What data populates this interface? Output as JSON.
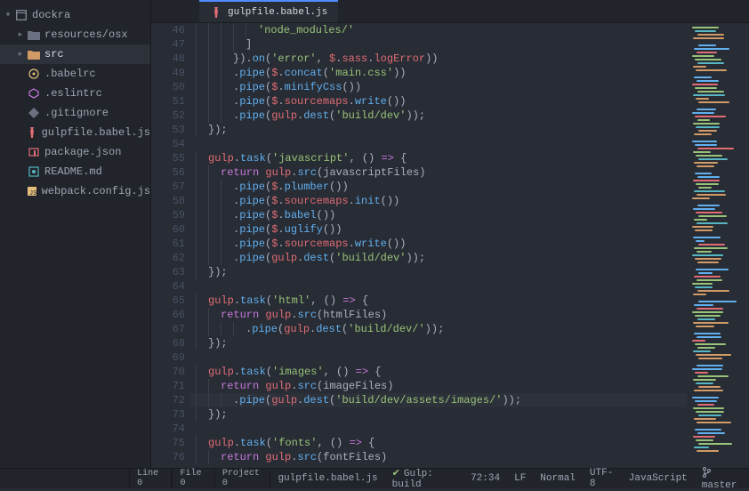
{
  "project": {
    "name": "dockra"
  },
  "tree": [
    {
      "label": "resources/osx",
      "depth": 1,
      "kind": "folder",
      "arrow": "▸",
      "sel": false
    },
    {
      "label": "src",
      "depth": 1,
      "kind": "folder-src",
      "arrow": "▸",
      "sel": true
    },
    {
      "label": ".babelrc",
      "depth": 1,
      "kind": "babel",
      "arrow": "",
      "sel": false
    },
    {
      "label": ".eslintrc",
      "depth": 1,
      "kind": "eslint",
      "arrow": "",
      "sel": false
    },
    {
      "label": ".gitignore",
      "depth": 1,
      "kind": "git",
      "arrow": "",
      "sel": false
    },
    {
      "label": "gulpfile.babel.js",
      "depth": 1,
      "kind": "gulp",
      "arrow": "",
      "sel": false
    },
    {
      "label": "package.json",
      "depth": 1,
      "kind": "npm",
      "arrow": "",
      "sel": false
    },
    {
      "label": "README.md",
      "depth": 1,
      "kind": "md",
      "arrow": "",
      "sel": false
    },
    {
      "label": "webpack.config.js",
      "depth": 1,
      "kind": "js",
      "arrow": "",
      "sel": false
    }
  ],
  "tab": {
    "label": "gulpfile.babel.js",
    "icon": "gulp"
  },
  "first_line": 46,
  "active_line": 72,
  "code": [
    [
      [
        "ind",
        5
      ],
      [
        "str",
        "'node_modules/'"
      ]
    ],
    [
      [
        "ind",
        4
      ],
      [
        "p",
        "]"
      ]
    ],
    [
      [
        "ind",
        3
      ],
      [
        "p",
        "})."
      ],
      [
        "fn",
        "on"
      ],
      [
        "p",
        "("
      ],
      [
        "str",
        "'error'"
      ],
      [
        "p",
        ", "
      ],
      [
        "var",
        "$"
      ],
      [
        "p",
        "."
      ],
      [
        "prop",
        "sass"
      ],
      [
        "p",
        "."
      ],
      [
        "prop",
        "logError"
      ],
      [
        "p",
        "))"
      ]
    ],
    [
      [
        "ind",
        3
      ],
      [
        "p",
        "."
      ],
      [
        "fn",
        "pipe"
      ],
      [
        "p",
        "("
      ],
      [
        "var",
        "$"
      ],
      [
        "p",
        "."
      ],
      [
        "fn",
        "concat"
      ],
      [
        "p",
        "("
      ],
      [
        "str",
        "'main.css'"
      ],
      [
        "p",
        "))"
      ]
    ],
    [
      [
        "ind",
        3
      ],
      [
        "p",
        "."
      ],
      [
        "fn",
        "pipe"
      ],
      [
        "p",
        "("
      ],
      [
        "var",
        "$"
      ],
      [
        "p",
        "."
      ],
      [
        "fn",
        "minifyCss"
      ],
      [
        "p",
        "())"
      ]
    ],
    [
      [
        "ind",
        3
      ],
      [
        "p",
        "."
      ],
      [
        "fn",
        "pipe"
      ],
      [
        "p",
        "("
      ],
      [
        "var",
        "$"
      ],
      [
        "p",
        "."
      ],
      [
        "prop",
        "sourcemaps"
      ],
      [
        "p",
        "."
      ],
      [
        "fn",
        "write"
      ],
      [
        "p",
        "())"
      ]
    ],
    [
      [
        "ind",
        3
      ],
      [
        "p",
        "."
      ],
      [
        "fn",
        "pipe"
      ],
      [
        "p",
        "("
      ],
      [
        "var",
        "gulp"
      ],
      [
        "p",
        "."
      ],
      [
        "fn",
        "dest"
      ],
      [
        "p",
        "("
      ],
      [
        "str",
        "'build/dev'"
      ],
      [
        "p",
        "));"
      ]
    ],
    [
      [
        "ind",
        1
      ],
      [
        "p",
        "});"
      ]
    ],
    [],
    [
      [
        "ind",
        1
      ],
      [
        "var",
        "gulp"
      ],
      [
        "p",
        "."
      ],
      [
        "fn",
        "task"
      ],
      [
        "p",
        "("
      ],
      [
        "str",
        "'javascript'"
      ],
      [
        "p",
        ", () "
      ],
      [
        "kw",
        "=>"
      ],
      [
        "p",
        " {"
      ]
    ],
    [
      [
        "ind",
        2
      ],
      [
        "kw",
        "return "
      ],
      [
        "var",
        "gulp"
      ],
      [
        "p",
        "."
      ],
      [
        "fn",
        "src"
      ],
      [
        "p",
        "(javascriptFiles)"
      ]
    ],
    [
      [
        "ind",
        3
      ],
      [
        "p",
        "."
      ],
      [
        "fn",
        "pipe"
      ],
      [
        "p",
        "("
      ],
      [
        "var",
        "$"
      ],
      [
        "p",
        "."
      ],
      [
        "fn",
        "plumber"
      ],
      [
        "p",
        "())"
      ]
    ],
    [
      [
        "ind",
        3
      ],
      [
        "p",
        "."
      ],
      [
        "fn",
        "pipe"
      ],
      [
        "p",
        "("
      ],
      [
        "var",
        "$"
      ],
      [
        "p",
        "."
      ],
      [
        "prop",
        "sourcemaps"
      ],
      [
        "p",
        "."
      ],
      [
        "fn",
        "init"
      ],
      [
        "p",
        "())"
      ]
    ],
    [
      [
        "ind",
        3
      ],
      [
        "p",
        "."
      ],
      [
        "fn",
        "pipe"
      ],
      [
        "p",
        "("
      ],
      [
        "var",
        "$"
      ],
      [
        "p",
        "."
      ],
      [
        "fn",
        "babel"
      ],
      [
        "p",
        "())"
      ]
    ],
    [
      [
        "ind",
        3
      ],
      [
        "p",
        "."
      ],
      [
        "fn",
        "pipe"
      ],
      [
        "p",
        "("
      ],
      [
        "var",
        "$"
      ],
      [
        "p",
        "."
      ],
      [
        "fn",
        "uglify"
      ],
      [
        "p",
        "())"
      ]
    ],
    [
      [
        "ind",
        3
      ],
      [
        "p",
        "."
      ],
      [
        "fn",
        "pipe"
      ],
      [
        "p",
        "("
      ],
      [
        "var",
        "$"
      ],
      [
        "p",
        "."
      ],
      [
        "prop",
        "sourcemaps"
      ],
      [
        "p",
        "."
      ],
      [
        "fn",
        "write"
      ],
      [
        "p",
        "())"
      ]
    ],
    [
      [
        "ind",
        3
      ],
      [
        "p",
        "."
      ],
      [
        "fn",
        "pipe"
      ],
      [
        "p",
        "("
      ],
      [
        "var",
        "gulp"
      ],
      [
        "p",
        "."
      ],
      [
        "fn",
        "dest"
      ],
      [
        "p",
        "("
      ],
      [
        "str",
        "'build/dev'"
      ],
      [
        "p",
        "));"
      ]
    ],
    [
      [
        "ind",
        1
      ],
      [
        "p",
        "});"
      ]
    ],
    [],
    [
      [
        "ind",
        1
      ],
      [
        "var",
        "gulp"
      ],
      [
        "p",
        "."
      ],
      [
        "fn",
        "task"
      ],
      [
        "p",
        "("
      ],
      [
        "str",
        "'html'"
      ],
      [
        "p",
        ", () "
      ],
      [
        "kw",
        "=>"
      ],
      [
        "p",
        " {"
      ]
    ],
    [
      [
        "ind",
        2
      ],
      [
        "kw",
        "return "
      ],
      [
        "var",
        "gulp"
      ],
      [
        "p",
        "."
      ],
      [
        "fn",
        "src"
      ],
      [
        "p",
        "(htmlFiles)"
      ]
    ],
    [
      [
        "ind",
        4
      ],
      [
        "p",
        "."
      ],
      [
        "fn",
        "pipe"
      ],
      [
        "p",
        "("
      ],
      [
        "var",
        "gulp"
      ],
      [
        "p",
        "."
      ],
      [
        "fn",
        "dest"
      ],
      [
        "p",
        "("
      ],
      [
        "str",
        "'build/dev/'"
      ],
      [
        "p",
        "));"
      ]
    ],
    [
      [
        "ind",
        1
      ],
      [
        "p",
        "});"
      ]
    ],
    [],
    [
      [
        "ind",
        1
      ],
      [
        "var",
        "gulp"
      ],
      [
        "p",
        "."
      ],
      [
        "fn",
        "task"
      ],
      [
        "p",
        "("
      ],
      [
        "str",
        "'images'"
      ],
      [
        "p",
        ", () "
      ],
      [
        "kw",
        "=>"
      ],
      [
        "p",
        " {"
      ]
    ],
    [
      [
        "ind",
        2
      ],
      [
        "kw",
        "return "
      ],
      [
        "var",
        "gulp"
      ],
      [
        "p",
        "."
      ],
      [
        "fn",
        "src"
      ],
      [
        "p",
        "(imageFiles)"
      ]
    ],
    [
      [
        "ind",
        3
      ],
      [
        "p",
        "."
      ],
      [
        "fn",
        "pipe"
      ],
      [
        "p",
        "("
      ],
      [
        "var",
        "gulp"
      ],
      [
        "p",
        "."
      ],
      [
        "fn",
        "dest"
      ],
      [
        "p",
        "("
      ],
      [
        "str",
        "'build/dev/assets/images/'"
      ],
      [
        "p",
        "));"
      ]
    ],
    [
      [
        "ind",
        1
      ],
      [
        "p",
        "});"
      ]
    ],
    [],
    [
      [
        "ind",
        1
      ],
      [
        "var",
        "gulp"
      ],
      [
        "p",
        "."
      ],
      [
        "fn",
        "task"
      ],
      [
        "p",
        "("
      ],
      [
        "str",
        "'fonts'"
      ],
      [
        "p",
        ", () "
      ],
      [
        "kw",
        "=>"
      ],
      [
        "p",
        " {"
      ]
    ],
    [
      [
        "ind",
        2
      ],
      [
        "kw",
        "return "
      ],
      [
        "var",
        "gulp"
      ],
      [
        "p",
        "."
      ],
      [
        "fn",
        "src"
      ],
      [
        "p",
        "(fontFiles)"
      ]
    ]
  ],
  "status": {
    "line": "Line 0",
    "file": "File 0",
    "project": "Project 0",
    "filename": "gulpfile.babel.js",
    "gulp": "Gulp: build",
    "pos": "72:34",
    "eol": "LF",
    "mode": "Normal",
    "enc": "UTF-8",
    "lang": "JavaScript",
    "branch": "master"
  },
  "minimap_colors": [
    "#98c379",
    "#e06c75",
    "#61afef",
    "#c678dd",
    "#d19a66",
    "#56b6c2"
  ]
}
